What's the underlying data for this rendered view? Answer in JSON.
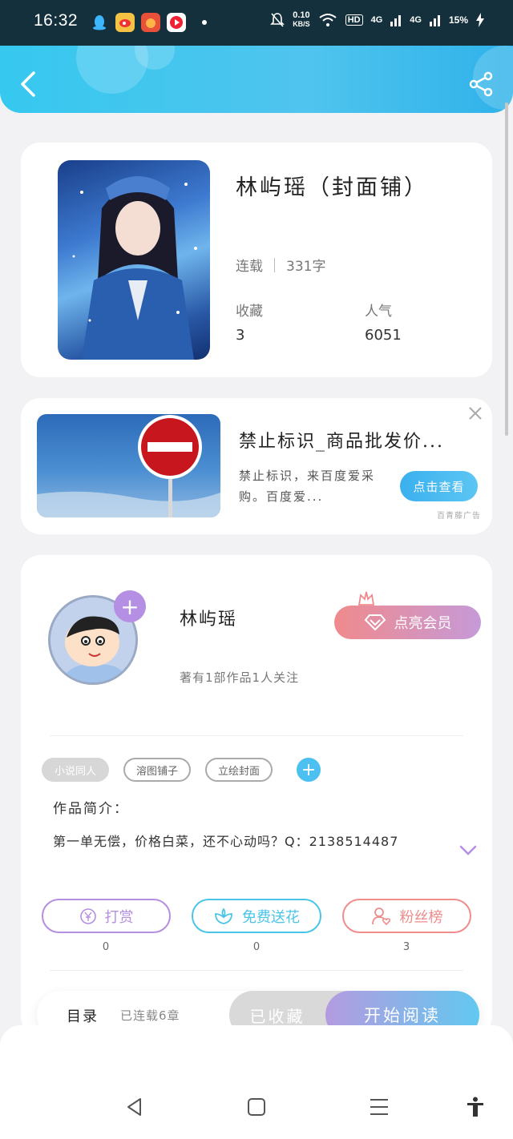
{
  "status_bar": {
    "time": "16:32",
    "speed_value": "0.10",
    "speed_unit": "KB/S",
    "hd_badge": "HD",
    "signal1": "4G",
    "signal2": "4G",
    "battery": "15%"
  },
  "book": {
    "title": "林屿瑶（封面铺）",
    "status": "连载",
    "word_count": "331字",
    "collect_label": "收藏",
    "collect_value": "3",
    "popularity_label": "人气",
    "popularity_value": "6051"
  },
  "ad": {
    "title": "禁止标识_商品批发价...",
    "description": "禁止标识，来百度爱采购。百度爱...",
    "button": "点击查看",
    "source": "百青藤广告"
  },
  "author": {
    "name": "林屿瑶",
    "stats": "著有1部作品1人关注",
    "vip_button": "点亮会员",
    "tags": [
      "小说同人",
      "溶图铺子",
      "立绘封面"
    ],
    "intro_label": "作品简介：",
    "intro_text": "第一单无偿，价格白菜，还不心动吗？Q：2138514487"
  },
  "actions": [
    {
      "label": "打赏",
      "count": "0",
      "color": "#b48fdf"
    },
    {
      "label": "免费送花",
      "count": "0",
      "color": "#4cc4e8"
    },
    {
      "label": "粉丝榜",
      "count": "3",
      "color": "#ef8c8c"
    }
  ],
  "bottom_bar": {
    "toc_label": "目录",
    "toc_count": "已连载6章",
    "fav_label": "已收藏",
    "read_label": "开始阅读"
  },
  "colors": {
    "header": "#3fc5ef",
    "accent_purple": "#b58fe3",
    "accent_blue": "#4cc0f0"
  }
}
